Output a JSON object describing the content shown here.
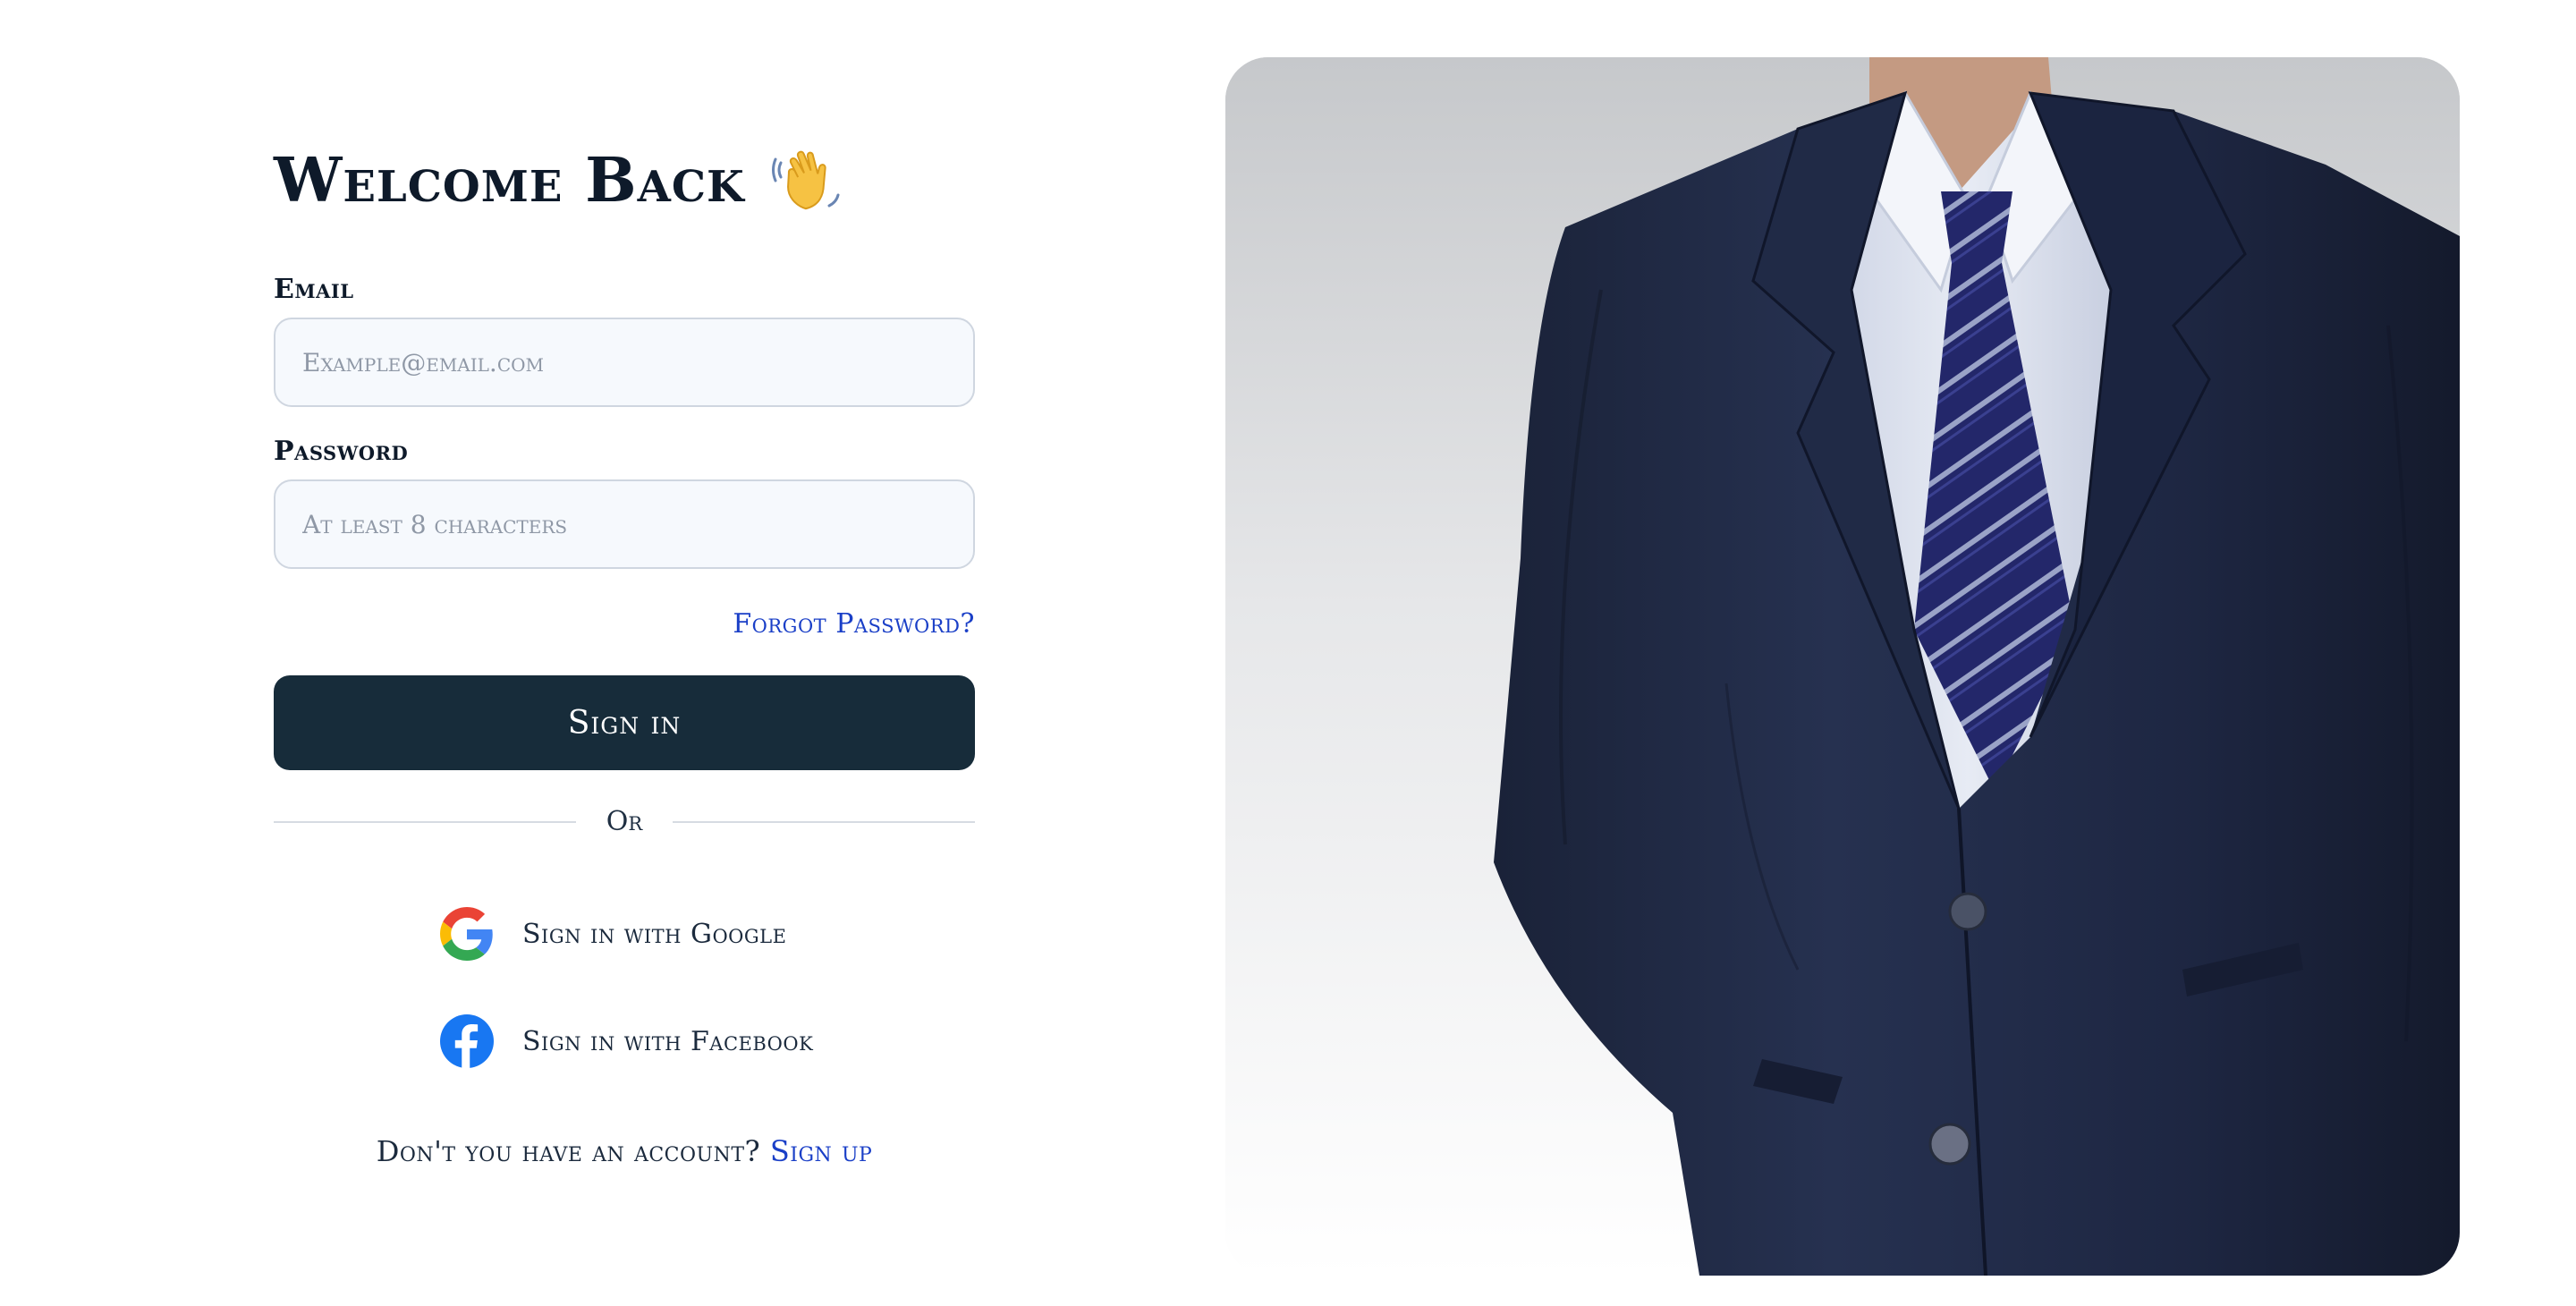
{
  "form": {
    "title": "Welcome Back",
    "title_icon": "waving-hand-icon",
    "email": {
      "label": "Email",
      "placeholder": "Example@email.com",
      "value": ""
    },
    "password": {
      "label": "Password",
      "placeholder": "At least 8 characters",
      "value": ""
    },
    "forgot_password": "Forgot Password?",
    "sign_in_button": "Sign in",
    "divider_text": "Or",
    "social": {
      "google": {
        "label": "Sign in with Google",
        "icon": "google-logo-icon"
      },
      "facebook": {
        "label": "Sign in with Facebook",
        "icon": "facebook-logo-icon"
      }
    },
    "signup_prompt": "Don't you have an account?",
    "signup_link": "Sign up"
  },
  "colors": {
    "primary_button": "#172c3a",
    "link": "#1a3fc7",
    "input_background": "#f6f9fd",
    "input_border": "#cfd6e0"
  }
}
